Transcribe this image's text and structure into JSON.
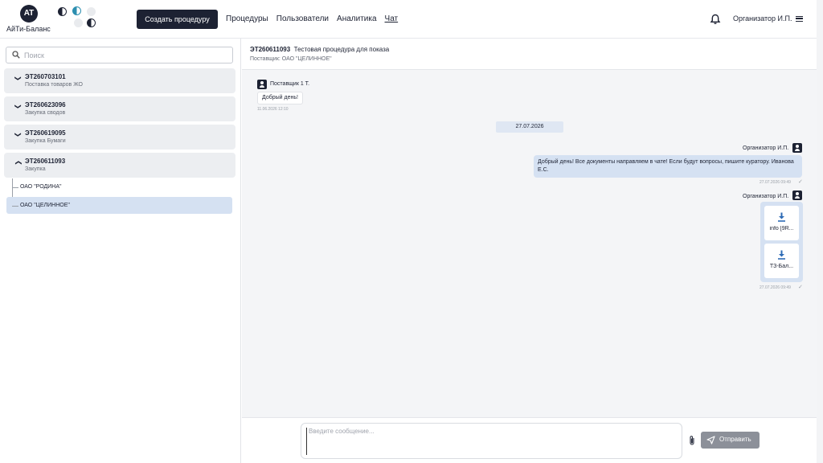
{
  "header": {
    "logo_mark": "AT",
    "logo_text": "АйТи-Баланс",
    "create_button": "Создать процедуру",
    "nav": [
      {
        "label": "Процедуры"
      },
      {
        "label": "Пользователи"
      },
      {
        "label": "Аналитика"
      },
      {
        "label": "Чат",
        "active": true
      }
    ],
    "user": "Организатор И.П."
  },
  "sidebar": {
    "search_placeholder": "Поиск",
    "procedures": [
      {
        "id": "ЭТ260703101",
        "desc": "Поставка товаров ЖО",
        "expanded": false
      },
      {
        "id": "ЭТ260623096",
        "desc": "Закупка сводов",
        "expanded": false
      },
      {
        "id": "ЭТ260619095",
        "desc": "Закупка Бумаги",
        "expanded": false
      },
      {
        "id": "ЭТ260611093",
        "desc": "Закупка",
        "expanded": true
      }
    ],
    "suppliers": [
      {
        "name": "ОАО \"РОДИНА\"",
        "selected": false
      },
      {
        "name": "ОАО \"ЦЕЛИННОЕ\"",
        "selected": true
      }
    ]
  },
  "chat": {
    "procedure_id": "ЭТ260611093",
    "procedure_title": "Тестовая процедура для показа",
    "subtitle": "Поставщик: ОАО \"ЦЕЛИННОЕ\"",
    "messages": [
      {
        "sender": "Поставщик 1 Т.",
        "text": "Добрый день!",
        "time": "11.06.2026 12:10"
      },
      {
        "sender": "Организатор И.П.",
        "text": "Добрый день! Все документы направляем в чате! Если будут вопросы, пишите куратору. Иванова Е.С.",
        "time": "27.07.2026 09:49"
      },
      {
        "sender": "Организатор И.П.",
        "files": [
          "info [9R...",
          "ТЗ-Бал..."
        ],
        "time": "27.07.2026 09:49"
      }
    ],
    "date_separator": "27.07.2026",
    "composer": {
      "placeholder": "Введите сообщение...",
      "send_label": "Отправить"
    }
  },
  "colors": {
    "primary": "#1d2233",
    "accent": "#2d6bb5",
    "bubble_out": "#d5e1f2",
    "send_disabled": "#8c9099"
  }
}
